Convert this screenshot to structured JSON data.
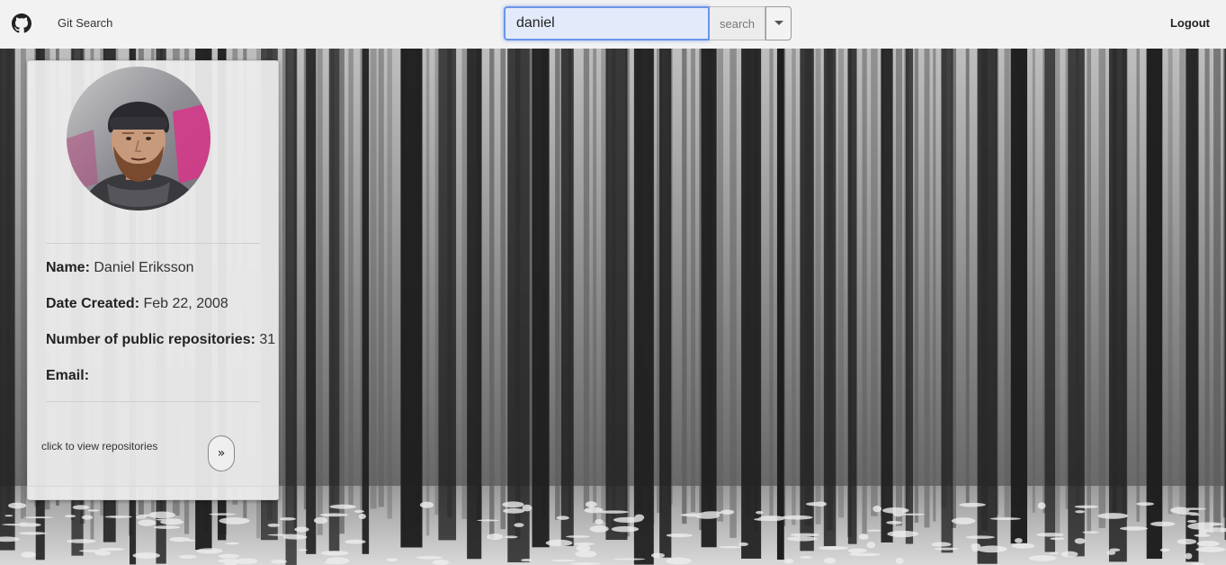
{
  "navbar": {
    "brand": "Git Search",
    "brand_icon": "github-icon",
    "search": {
      "value": "daniel",
      "button_label": "search",
      "dropdown_icon": "caret-down-icon"
    },
    "logout_label": "Logout"
  },
  "profile": {
    "avatar_icon": "user-avatar",
    "name_label": "Name:",
    "name_value": "Daniel Eriksson",
    "date_label": "Date Created:",
    "date_value": "Feb 22, 2008",
    "repos_label": "Number of public repositories:",
    "repos_value": "31",
    "email_label": "Email:",
    "email_value": "",
    "view_repos_hint": "click to view repositories",
    "view_repos_button": "»"
  },
  "colors": {
    "navbar_bg": "#f2f2f2",
    "input_focus": "#6c95e8",
    "card_bg": "#ececec"
  }
}
